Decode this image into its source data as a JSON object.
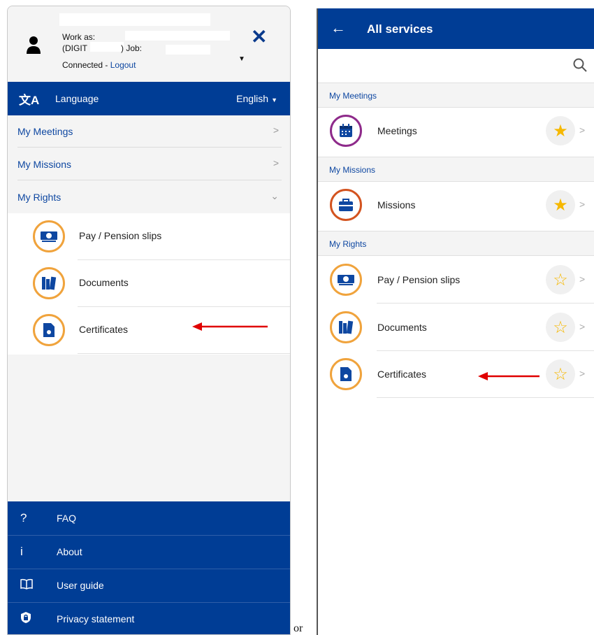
{
  "left_panel": {
    "user": {
      "work_as": "Work as:",
      "digit_prefix": "(DIGIT",
      "digit_suffix": ") Job:",
      "connected": "Connected - ",
      "logout": "Logout"
    },
    "language": {
      "label": "Language",
      "value": "English"
    },
    "sections": [
      "My Meetings",
      "My Missions",
      "My Rights"
    ],
    "rights_items": [
      "Pay / Pension slips",
      "Documents",
      "Certificates"
    ],
    "bottom_nav": [
      {
        "icon": "?",
        "label": "FAQ"
      },
      {
        "icon": "i",
        "label": "About"
      },
      {
        "icon": "book-icon",
        "label": "User guide"
      },
      {
        "icon": "shield-lock-icon",
        "label": "Privacy statement"
      }
    ]
  },
  "separator_text": "or",
  "right_panel": {
    "title": "All services",
    "groups": [
      {
        "label": "My Meetings",
        "items": [
          {
            "label": "Meetings",
            "starred": true
          }
        ]
      },
      {
        "label": "My Missions",
        "items": [
          {
            "label": "Missions",
            "starred": true
          }
        ]
      },
      {
        "label": "My Rights",
        "items": [
          {
            "label": "Pay / Pension slips",
            "starred": false
          },
          {
            "label": "Documents",
            "starred": false
          },
          {
            "label": "Certificates",
            "starred": false
          }
        ]
      }
    ]
  },
  "colors": {
    "primary_blue": "#003d95",
    "link_blue": "#0e47a1",
    "icon_orange": "#f0a33c",
    "meetings_purple": "#8e2a8a",
    "missions_orange": "#d3531f",
    "star_yellow": "#f6b800",
    "annotation_red": "#e00000"
  }
}
